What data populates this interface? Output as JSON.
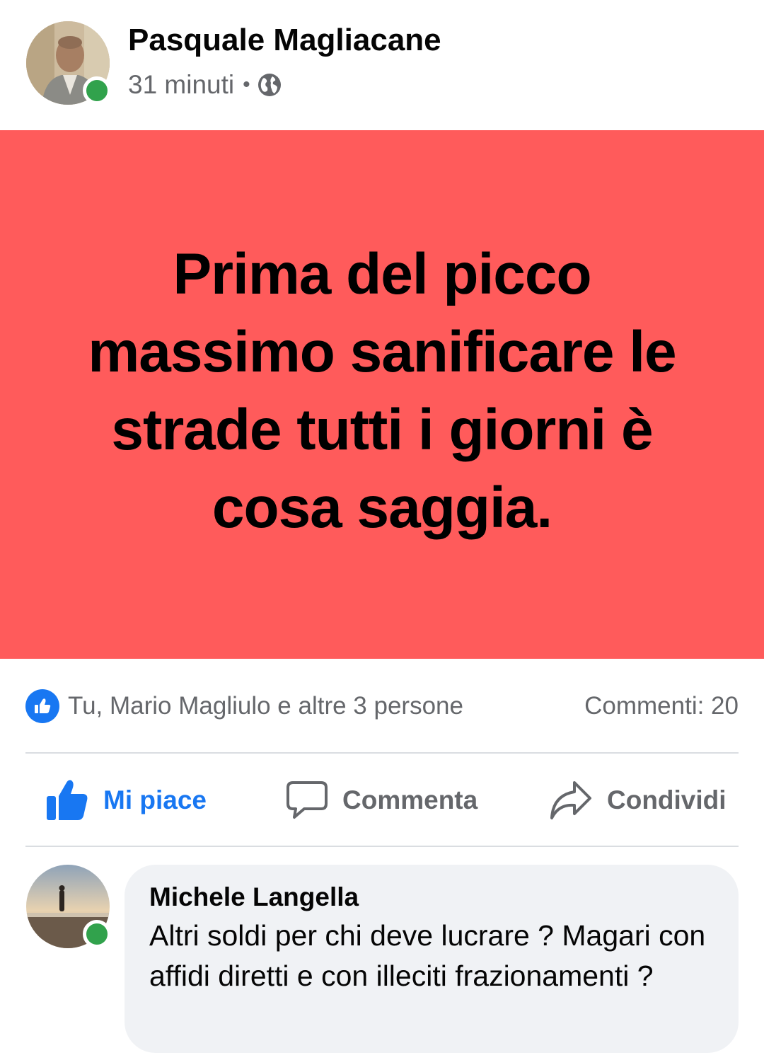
{
  "post": {
    "author": "Pasquale Magliacane",
    "time": "31 minuti",
    "separator": "•",
    "privacy_icon": "globe-icon",
    "author_online": true,
    "text": "Prima del picco massimo sanificare le strade tutti i giorni è cosa saggia.",
    "background_color": "#ff5b5b"
  },
  "reactions": {
    "icon": "like-icon",
    "summary": "Tu, Mario Magliulo e altre 3 persone",
    "comments_count": "Commenti: 20"
  },
  "actions": {
    "like_label": "Mi piace",
    "like_active": true,
    "comment_label": "Commenta",
    "share_label": "Condividi"
  },
  "comment": {
    "author": "Michele Langella",
    "text": "Altri soldi per chi deve lucrare ? Magari con affidi diretti e con illeciti frazionamenti ?",
    "author_online": true
  },
  "colors": {
    "accent": "#1877f2",
    "online": "#31a24c",
    "secondary_text": "#65676b",
    "bubble": "#f0f2f5"
  }
}
